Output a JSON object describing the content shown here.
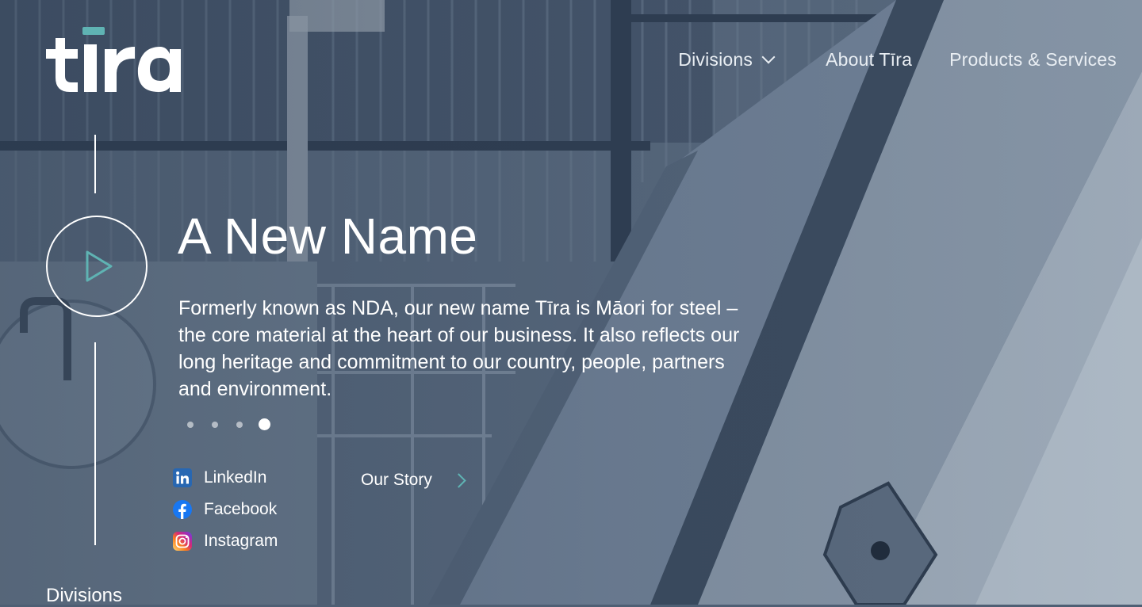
{
  "brand": {
    "name": "tīra",
    "accent": "#5fb3b3"
  },
  "nav": {
    "items": [
      {
        "label": "Divisions",
        "has_dropdown": true
      },
      {
        "label": "About Tīra",
        "has_dropdown": false
      },
      {
        "label": "Products & Services",
        "has_dropdown": false
      }
    ]
  },
  "hero": {
    "title": "A New Name",
    "description": "Formerly known as NDA, our new name Tīra is Māori for steel – the core material at the heart of our business. It also reflects our long heritage and commitment to our country, people, partners and environment.",
    "play_icon": "play-icon",
    "slides": {
      "count": 4,
      "active": 4
    }
  },
  "social": [
    {
      "label": "LinkedIn",
      "icon": "linkedin-icon"
    },
    {
      "label": "Facebook",
      "icon": "facebook-icon"
    },
    {
      "label": "Instagram",
      "icon": "instagram-icon"
    }
  ],
  "cta": {
    "label": "Our Story",
    "icon": "chevron-right-icon"
  },
  "section_label": "Divisions",
  "colors": {
    "text": "#ffffff",
    "nav_text": "#e9eef3",
    "overlay": "#4e5f74"
  }
}
